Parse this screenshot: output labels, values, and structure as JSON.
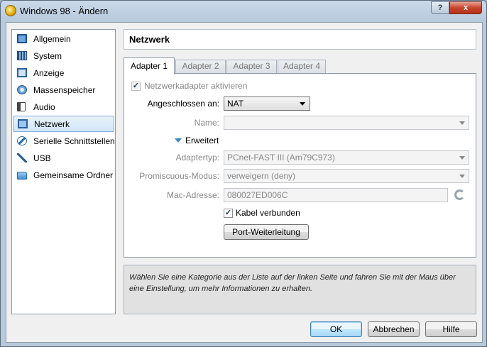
{
  "window": {
    "title": "Windows 98 - Ändern",
    "help_button": "?",
    "close_button": "x"
  },
  "sidebar": {
    "items": [
      {
        "label": "Allgemein",
        "icon": "monitor-icon"
      },
      {
        "label": "System",
        "icon": "chip-icon"
      },
      {
        "label": "Anzeige",
        "icon": "display-icon"
      },
      {
        "label": "Massenspeicher",
        "icon": "disk-icon"
      },
      {
        "label": "Audio",
        "icon": "speaker-icon"
      },
      {
        "label": "Netzwerk",
        "icon": "network-icon",
        "selected": true
      },
      {
        "label": "Serielle Schnittstellen",
        "icon": "serial-port-icon"
      },
      {
        "label": "USB",
        "icon": "usb-icon"
      },
      {
        "label": "Gemeinsame Ordner",
        "icon": "folder-icon"
      }
    ]
  },
  "page": {
    "title": "Netzwerk"
  },
  "tabs": [
    {
      "label": "Adapter 1",
      "active": true
    },
    {
      "label": "Adapter 2"
    },
    {
      "label": "Adapter 3"
    },
    {
      "label": "Adapter 4"
    }
  ],
  "adapter": {
    "enable_label": "Netzwerkadapter aktivieren",
    "enable_checked": true,
    "attached_label": "Angeschlossen an:",
    "attached_value": "NAT",
    "name_label": "Name:",
    "name_value": "",
    "advanced_label": "Erweitert",
    "type_label": "Adaptertyp:",
    "type_value": "PCnet-FAST III (Am79C973)",
    "promisc_label": "Promiscuous-Modus:",
    "promisc_value": "verweigern (deny)",
    "mac_label": "Mac-Adresse:",
    "mac_value": "080027ED006C",
    "cable_label": "Kabel verbunden",
    "cable_checked": true,
    "port_forward_label": "Port-Weiterleitung"
  },
  "info": {
    "text": "Wählen Sie eine Kategorie aus der Liste auf der linken Seite und fahren Sie mit der Maus über eine Einstellung, um mehr Informationen zu erhalten."
  },
  "buttons": {
    "ok": "OK",
    "cancel": "Abbrechen",
    "help": "Hilfe"
  }
}
